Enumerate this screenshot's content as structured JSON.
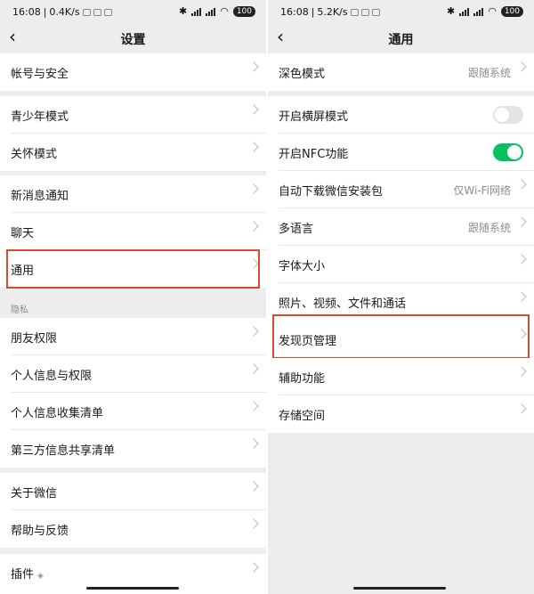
{
  "left": {
    "status": {
      "time": "16:08",
      "speed": "0.4K/s",
      "battery": "100"
    },
    "title": "设置",
    "groups": [
      [
        "帐号与安全"
      ],
      [
        "青少年模式",
        "关怀模式"
      ],
      [
        "新消息通知",
        "聊天",
        "通用"
      ]
    ],
    "privacy_header": "隐私",
    "privacy_items": [
      "朋友权限",
      "个人信息与权限",
      "个人信息收集清单",
      "第三方信息共享清单"
    ],
    "about_items": [
      "关于微信",
      "帮助与反馈"
    ],
    "plugins_label": "插件",
    "highlighted": "通用"
  },
  "right": {
    "status": {
      "time": "16:08",
      "speed": "5.2K/s",
      "battery": "100"
    },
    "title": "通用",
    "dark_mode": {
      "label": "深色模式",
      "value": "跟随系统"
    },
    "landscape": {
      "label": "开启横屏模式",
      "on": false
    },
    "nfc": {
      "label": "开启NFC功能",
      "on": true
    },
    "auto_download": {
      "label": "自动下载微信安装包",
      "value": "仅Wi-Fi网络"
    },
    "language": {
      "label": "多语言",
      "value": "跟随系统"
    },
    "font_size": {
      "label": "字体大小"
    },
    "media": {
      "label": "照片、视频、文件和通话"
    },
    "discover": {
      "label": "发现页管理"
    },
    "accessibility": {
      "label": "辅助功能"
    },
    "storage": {
      "label": "存储空间"
    },
    "highlighted": "发现页管理"
  },
  "colors": {
    "highlight": "#d64a30",
    "toggle_on": "#07c160",
    "background": "#ededed"
  }
}
